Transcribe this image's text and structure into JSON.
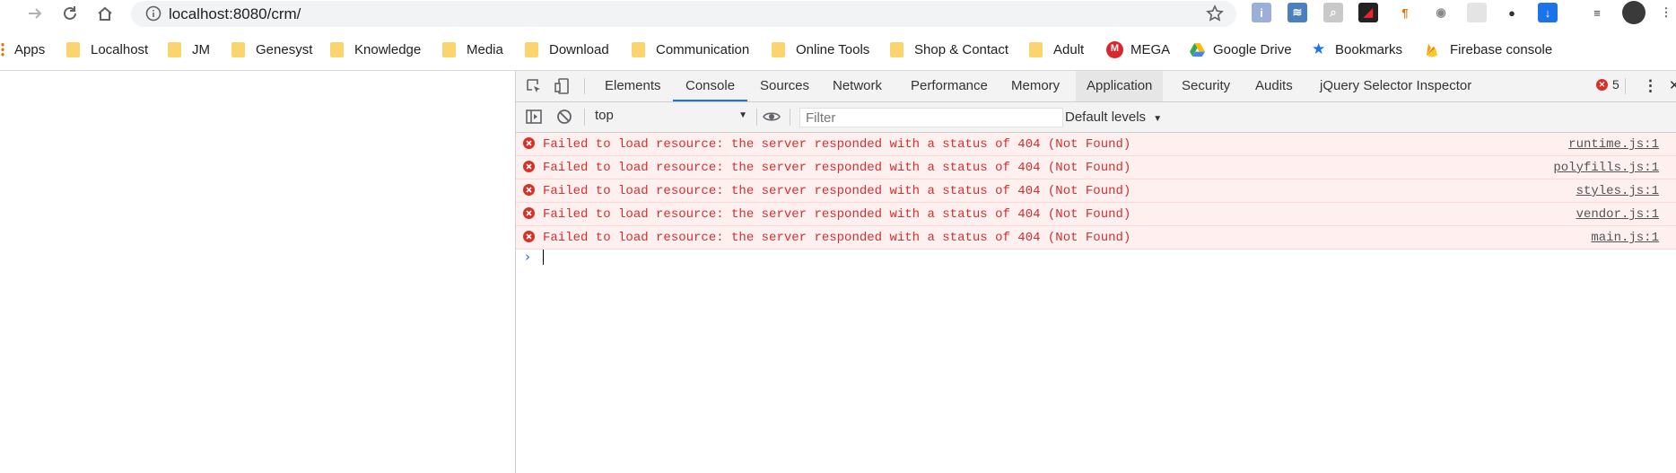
{
  "browser": {
    "url": "localhost:8080/crm/"
  },
  "bookmarks": [
    {
      "label": "Apps",
      "type": "apps"
    },
    {
      "label": "Localhost",
      "type": "folder"
    },
    {
      "label": "JM",
      "type": "folder"
    },
    {
      "label": "Genesyst",
      "type": "folder"
    },
    {
      "label": "Knowledge",
      "type": "folder"
    },
    {
      "label": "Media",
      "type": "folder"
    },
    {
      "label": "Download",
      "type": "folder"
    },
    {
      "label": "Communication",
      "type": "folder"
    },
    {
      "label": "Online Tools",
      "type": "folder"
    },
    {
      "label": "Shop & Contact",
      "type": "folder"
    },
    {
      "label": "Adult",
      "type": "folder"
    },
    {
      "label": "MEGA",
      "type": "mega"
    },
    {
      "label": "Google Drive",
      "type": "drive"
    },
    {
      "label": "Bookmarks",
      "type": "star"
    },
    {
      "label": "Firebase console",
      "type": "firebase"
    }
  ],
  "devtools": {
    "tabs": [
      "Elements",
      "Console",
      "Sources",
      "Network",
      "Performance",
      "Memory",
      "Application",
      "Security",
      "Audits",
      "jQuery Selector Inspector"
    ],
    "active_tab": "Console",
    "error_count": "5",
    "context": "top",
    "filter_placeholder": "Filter",
    "levels": "Default levels",
    "messages": [
      {
        "text": "Failed to load resource: the server responded with a status of 404 (Not Found)",
        "source": "runtime.js:1"
      },
      {
        "text": "Failed to load resource: the server responded with a status of 404 (Not Found)",
        "source": "polyfills.js:1"
      },
      {
        "text": "Failed to load resource: the server responded with a status of 404 (Not Found)",
        "source": "styles.js:1"
      },
      {
        "text": "Failed to load resource: the server responded with a status of 404 (Not Found)",
        "source": "vendor.js:1"
      },
      {
        "text": "Failed to load resource: the server responded with a status of 404 (Not Found)",
        "source": "main.js:1"
      }
    ],
    "prompt": "›"
  },
  "colors": {
    "error_text": "#d32f2f",
    "error_bg": "#fff0f0",
    "accent": "#1a73e8",
    "folder": "#fbd46d"
  }
}
